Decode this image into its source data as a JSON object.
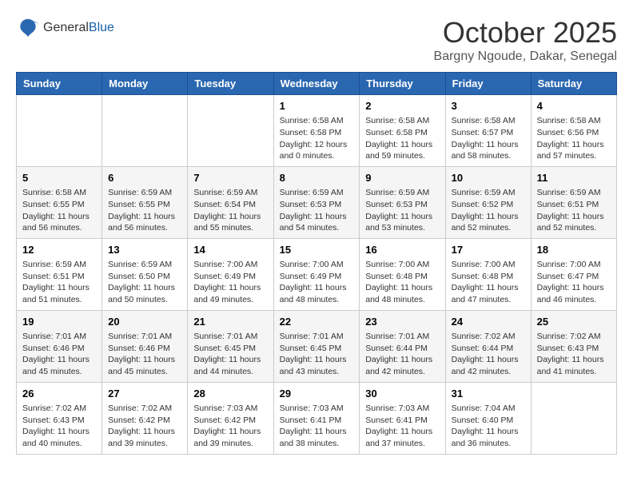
{
  "header": {
    "logo_general": "General",
    "logo_blue": "Blue",
    "month_title": "October 2025",
    "subtitle": "Bargny Ngoude, Dakar, Senegal"
  },
  "weekdays": [
    "Sunday",
    "Monday",
    "Tuesday",
    "Wednesday",
    "Thursday",
    "Friday",
    "Saturday"
  ],
  "weeks": [
    [
      {
        "day": "",
        "info": ""
      },
      {
        "day": "",
        "info": ""
      },
      {
        "day": "",
        "info": ""
      },
      {
        "day": "1",
        "info": "Sunrise: 6:58 AM\nSunset: 6:58 PM\nDaylight: 12 hours and 0 minutes."
      },
      {
        "day": "2",
        "info": "Sunrise: 6:58 AM\nSunset: 6:58 PM\nDaylight: 11 hours and 59 minutes."
      },
      {
        "day": "3",
        "info": "Sunrise: 6:58 AM\nSunset: 6:57 PM\nDaylight: 11 hours and 58 minutes."
      },
      {
        "day": "4",
        "info": "Sunrise: 6:58 AM\nSunset: 6:56 PM\nDaylight: 11 hours and 57 minutes."
      }
    ],
    [
      {
        "day": "5",
        "info": "Sunrise: 6:58 AM\nSunset: 6:55 PM\nDaylight: 11 hours and 56 minutes."
      },
      {
        "day": "6",
        "info": "Sunrise: 6:59 AM\nSunset: 6:55 PM\nDaylight: 11 hours and 56 minutes."
      },
      {
        "day": "7",
        "info": "Sunrise: 6:59 AM\nSunset: 6:54 PM\nDaylight: 11 hours and 55 minutes."
      },
      {
        "day": "8",
        "info": "Sunrise: 6:59 AM\nSunset: 6:53 PM\nDaylight: 11 hours and 54 minutes."
      },
      {
        "day": "9",
        "info": "Sunrise: 6:59 AM\nSunset: 6:53 PM\nDaylight: 11 hours and 53 minutes."
      },
      {
        "day": "10",
        "info": "Sunrise: 6:59 AM\nSunset: 6:52 PM\nDaylight: 11 hours and 52 minutes."
      },
      {
        "day": "11",
        "info": "Sunrise: 6:59 AM\nSunset: 6:51 PM\nDaylight: 11 hours and 52 minutes."
      }
    ],
    [
      {
        "day": "12",
        "info": "Sunrise: 6:59 AM\nSunset: 6:51 PM\nDaylight: 11 hours and 51 minutes."
      },
      {
        "day": "13",
        "info": "Sunrise: 6:59 AM\nSunset: 6:50 PM\nDaylight: 11 hours and 50 minutes."
      },
      {
        "day": "14",
        "info": "Sunrise: 7:00 AM\nSunset: 6:49 PM\nDaylight: 11 hours and 49 minutes."
      },
      {
        "day": "15",
        "info": "Sunrise: 7:00 AM\nSunset: 6:49 PM\nDaylight: 11 hours and 48 minutes."
      },
      {
        "day": "16",
        "info": "Sunrise: 7:00 AM\nSunset: 6:48 PM\nDaylight: 11 hours and 48 minutes."
      },
      {
        "day": "17",
        "info": "Sunrise: 7:00 AM\nSunset: 6:48 PM\nDaylight: 11 hours and 47 minutes."
      },
      {
        "day": "18",
        "info": "Sunrise: 7:00 AM\nSunset: 6:47 PM\nDaylight: 11 hours and 46 minutes."
      }
    ],
    [
      {
        "day": "19",
        "info": "Sunrise: 7:01 AM\nSunset: 6:46 PM\nDaylight: 11 hours and 45 minutes."
      },
      {
        "day": "20",
        "info": "Sunrise: 7:01 AM\nSunset: 6:46 PM\nDaylight: 11 hours and 45 minutes."
      },
      {
        "day": "21",
        "info": "Sunrise: 7:01 AM\nSunset: 6:45 PM\nDaylight: 11 hours and 44 minutes."
      },
      {
        "day": "22",
        "info": "Sunrise: 7:01 AM\nSunset: 6:45 PM\nDaylight: 11 hours and 43 minutes."
      },
      {
        "day": "23",
        "info": "Sunrise: 7:01 AM\nSunset: 6:44 PM\nDaylight: 11 hours and 42 minutes."
      },
      {
        "day": "24",
        "info": "Sunrise: 7:02 AM\nSunset: 6:44 PM\nDaylight: 11 hours and 42 minutes."
      },
      {
        "day": "25",
        "info": "Sunrise: 7:02 AM\nSunset: 6:43 PM\nDaylight: 11 hours and 41 minutes."
      }
    ],
    [
      {
        "day": "26",
        "info": "Sunrise: 7:02 AM\nSunset: 6:43 PM\nDaylight: 11 hours and 40 minutes."
      },
      {
        "day": "27",
        "info": "Sunrise: 7:02 AM\nSunset: 6:42 PM\nDaylight: 11 hours and 39 minutes."
      },
      {
        "day": "28",
        "info": "Sunrise: 7:03 AM\nSunset: 6:42 PM\nDaylight: 11 hours and 39 minutes."
      },
      {
        "day": "29",
        "info": "Sunrise: 7:03 AM\nSunset: 6:41 PM\nDaylight: 11 hours and 38 minutes."
      },
      {
        "day": "30",
        "info": "Sunrise: 7:03 AM\nSunset: 6:41 PM\nDaylight: 11 hours and 37 minutes."
      },
      {
        "day": "31",
        "info": "Sunrise: 7:04 AM\nSunset: 6:40 PM\nDaylight: 11 hours and 36 minutes."
      },
      {
        "day": "",
        "info": ""
      }
    ]
  ]
}
